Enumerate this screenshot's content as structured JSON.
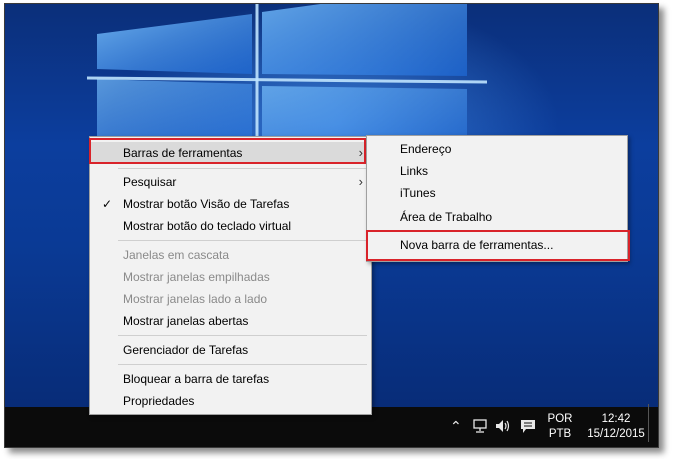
{
  "context_menu": {
    "items": [
      {
        "label": "Barras de ferramentas",
        "has_submenu": true,
        "highlighted": true
      },
      {
        "label": "Pesquisar",
        "has_submenu": true
      },
      {
        "label": "Mostrar botão Visão de Tarefas",
        "checked": true
      },
      {
        "label": "Mostrar botão do teclado virtual"
      },
      {
        "label": "Janelas em cascata",
        "disabled": true
      },
      {
        "label": "Mostrar janelas empilhadas",
        "disabled": true
      },
      {
        "label": "Mostrar janelas lado a lado",
        "disabled": true
      },
      {
        "label": "Mostrar janelas abertas"
      },
      {
        "label": "Gerenciador de Tarefas"
      },
      {
        "label": "Bloquear a barra de tarefas"
      },
      {
        "label": "Propriedades"
      }
    ]
  },
  "submenu": {
    "items": [
      {
        "label": "Endereço"
      },
      {
        "label": "Links"
      },
      {
        "label": "iTunes"
      },
      {
        "label": "Área de Trabalho"
      },
      {
        "label": "Nova barra de ferramentas...",
        "highlighted": true
      }
    ]
  },
  "taskbar": {
    "language_top": "POR",
    "language_bottom": "PTB",
    "time": "12:42",
    "date": "15/12/2015",
    "tray_icons": [
      "chevron-up-icon",
      "network-icon",
      "volume-icon",
      "action-center-icon"
    ]
  },
  "colors": {
    "highlight_border": "#d9232a",
    "menu_background": "#f2f2f2",
    "desktop_blue": "#0c3e9e"
  }
}
